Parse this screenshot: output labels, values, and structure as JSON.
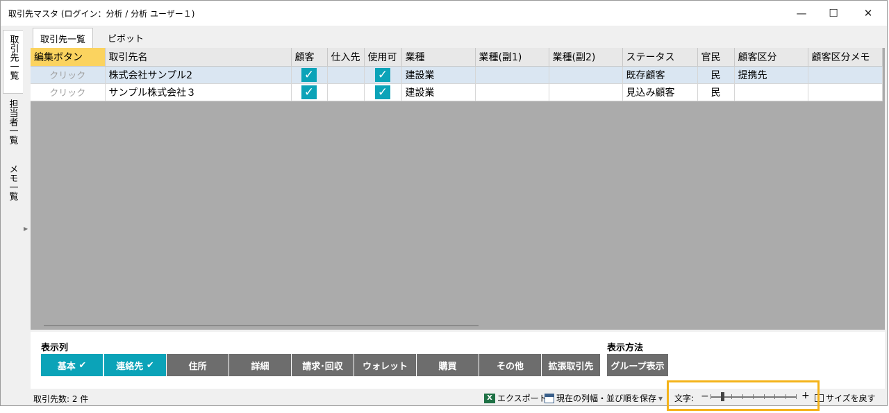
{
  "window": {
    "title": "取引先マスタ (ログイン：分析 / 分析 ユーザー１)",
    "minimize_glyph": "—",
    "maximize_glyph": "☐",
    "close_glyph": "✕"
  },
  "side_tabs": [
    {
      "label": "取引先一覧",
      "active": true
    },
    {
      "label": "担当者一覧",
      "active": false
    },
    {
      "label": "メモ一覧",
      "active": false
    }
  ],
  "top_tabs": [
    {
      "label": "取引先一覧",
      "active": true
    },
    {
      "label": "ピボット",
      "active": false
    }
  ],
  "grid": {
    "columns": [
      "編集ボタン",
      "取引先名",
      "顧客",
      "仕入先",
      "使用可",
      "業種",
      "業種(副1)",
      "業種(副2)",
      "ステータス",
      "官民",
      "顧客区分",
      "顧客区分メモ"
    ],
    "rows": [
      {
        "edit": "クリック",
        "name": "株式会社サンプル2",
        "customer": true,
        "supplier": false,
        "usable": true,
        "industry": "建設業",
        "industry_sub1": "",
        "industry_sub2": "",
        "status": "既存顧客",
        "public_private": "民",
        "customer_category": "提携先",
        "customer_category_memo": ""
      },
      {
        "edit": "クリック",
        "name": "サンプル株式会社３",
        "customer": true,
        "supplier": false,
        "usable": true,
        "industry": "建設業",
        "industry_sub1": "",
        "industry_sub2": "",
        "status": "見込み顧客",
        "public_private": "民",
        "customer_category": "",
        "customer_category_memo": ""
      }
    ]
  },
  "display_columns": {
    "label": "表示列",
    "buttons": [
      {
        "label": "基本",
        "checked": true
      },
      {
        "label": "連絡先",
        "checked": true
      },
      {
        "label": "住所",
        "checked": false
      },
      {
        "label": "詳細",
        "checked": false
      },
      {
        "label": "請求･回収",
        "checked": false
      },
      {
        "label": "ウォレット",
        "checked": false
      },
      {
        "label": "購買",
        "checked": false
      },
      {
        "label": "その他",
        "checked": false
      },
      {
        "label": "拡張取引先",
        "checked": false
      }
    ]
  },
  "display_method": {
    "label": "表示方法",
    "button": "グループ表示"
  },
  "statusbar": {
    "count": "取引先数: 2 件",
    "export": "エクスポート",
    "export_icon": "X",
    "save_layout": "現在の列幅・並び順を保存",
    "dropdown_glyph": "▾",
    "font_label": "文字:",
    "minus_glyph": "−",
    "plus_glyph": "+",
    "reset_size": "サイズを戻す",
    "zoom_level_fraction": 0.12
  },
  "colors": {
    "accent": "#0ba3b8",
    "header_selected": "#fbd35f",
    "row_selected": "#dae6f2",
    "button_off": "#6d6d6d",
    "highlight_box": "#f4b31a"
  }
}
